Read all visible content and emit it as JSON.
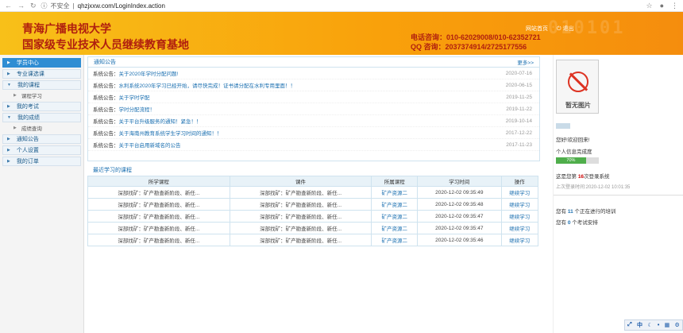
{
  "browser": {
    "insecure_label": "不安全",
    "url": "qhzjxxw.com/LoginIndex.action"
  },
  "banner": {
    "title1": "青海广播电视大学",
    "title2": "国家级专业技术人员继续教育基地",
    "phone": "电话咨询：010-62029008/010-62352721",
    "qq": "QQ 咨询：2037374914/2725177556",
    "link_home": "网站首页",
    "link_logout": "退出",
    "deco": "010101"
  },
  "sidebar": {
    "items": [
      {
        "label": "学员中心"
      },
      {
        "label": "专业课选课"
      },
      {
        "label": "我的课程"
      },
      {
        "label": "课程学习"
      },
      {
        "label": "我的考试"
      },
      {
        "label": "我的成绩"
      },
      {
        "label": "成绩查询"
      },
      {
        "label": "通知公告"
      },
      {
        "label": "个人设置"
      },
      {
        "label": "我的订单"
      }
    ]
  },
  "notice": {
    "title": "通知公告",
    "more": "更多>>",
    "prefix": "系统公告：",
    "items": [
      {
        "text": "关于2020年学时分配问题!",
        "date": "2020-07-16"
      },
      {
        "text": "水利系统2020年学习已经开始，请尽快完成！证书请分配在水利专用里面！！",
        "date": "2020-06-15"
      },
      {
        "text": "关于学时学配",
        "date": "2019-11-25"
      },
      {
        "text": "学时分配流程！",
        "date": "2019-11-22"
      },
      {
        "text": "关于平台升级服务的通知！紧急！！",
        "date": "2019-10-14"
      },
      {
        "text": "关于海南州教育系统学生学习时间的通知！！",
        "date": "2017-12-22"
      },
      {
        "text": "关于平台启用新域名的公告",
        "date": "2017-11-23"
      }
    ]
  },
  "courses": {
    "title": "最近学习的课程",
    "headers": [
      "所学课程",
      "课件",
      "所属课程",
      "学习时间",
      "操作"
    ],
    "rows": [
      {
        "course": "深部找矿：矿产勘查新阶段、新任...",
        "ware": "深部找矿：矿产勘查新阶段、新任...",
        "belong": "矿产资源二",
        "time": "2020-12-02 09:35:49",
        "op": "继续学习"
      },
      {
        "course": "深部找矿：矿产勘查新阶段、新任...",
        "ware": "深部找矿：矿产勘查新阶段、新任...",
        "belong": "矿产资源二",
        "time": "2020-12-02 09:35:48",
        "op": "继续学习"
      },
      {
        "course": "深部找矿：矿产勘查新阶段、新任...",
        "ware": "深部找矿：矿产勘查新阶段、新任...",
        "belong": "矿产资源二",
        "time": "2020-12-02 09:35:47",
        "op": "继续学习"
      },
      {
        "course": "深部找矿：矿产勘查新阶段、新任...",
        "ware": "深部找矿：矿产勘查新阶段、新任...",
        "belong": "矿产资源二",
        "time": "2020-12-02 09:35:47",
        "op": "继续学习"
      },
      {
        "course": "深部找矿：矿产勘查新阶段、新任...",
        "ware": "深部找矿：矿产勘查新阶段、新任...",
        "belong": "矿产资源二",
        "time": "2020-12-02 09:35:46",
        "op": "继续学习"
      }
    ]
  },
  "profile": {
    "avatar_caption": "暂无图片",
    "welcome": "您好!欢迎回来!",
    "info_label": "个人信息完成度",
    "progress_text": "70%",
    "progress_value": 0.7,
    "login_pre": "这是您第",
    "login_count": "16",
    "login_post": "次登录系统",
    "last_login": "上次登录时间:2020-12-02 10:01:35",
    "training_pre": "您有",
    "training_count": "11",
    "training_post": "个正在进行的培训",
    "exam_pre": "您有",
    "exam_count": "0",
    "exam_post": "个考试安排"
  },
  "ime": {
    "mode": "中"
  }
}
